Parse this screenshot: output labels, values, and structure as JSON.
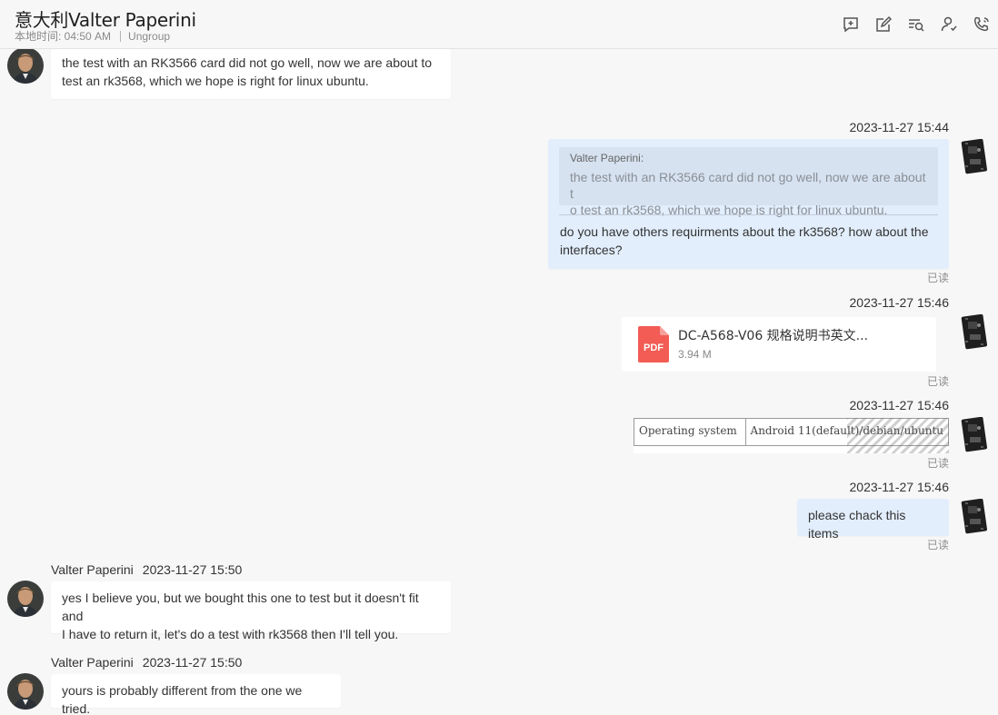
{
  "header": {
    "title": "意大利Valter Paperini",
    "local_time_label": "本地时间: 04:50 AM",
    "group": "Ungroup",
    "tools": [
      "new-message-icon",
      "edit-note-icon",
      "search-history-icon",
      "contact-card-icon",
      "phone-call-icon"
    ]
  },
  "messages": [
    {
      "direction": "incoming",
      "text_line1": "the test with an RK3566 card did not go well, now we are about to",
      "text_line2": "test an rk3568, which we hope is right for linux ubuntu."
    },
    {
      "direction": "outgoing",
      "timestamp": "2023-11-27 15:44",
      "quote_author": "Valter Paperini:",
      "quote_line1": "the test with an RK3566 card did not go well, now we are about t",
      "quote_line2": "o test an rk3568, which we hope is right for linux ubuntu.",
      "text_line1": "do you have others requirments about the rk3568? how about the",
      "text_line2": "interfaces?",
      "status": "已读"
    },
    {
      "direction": "outgoing",
      "timestamp": "2023-11-27 15:46",
      "file_type": "PDF",
      "file_name": "DC-A568-V06 规格说明书英文...",
      "file_size": "3.94 M",
      "status": "已读"
    },
    {
      "direction": "outgoing",
      "timestamp": "2023-11-27 15:46",
      "image_cell1": "Operating system",
      "image_cell2": "Android 11(default)/debian/ubuntu",
      "status": "已读"
    },
    {
      "direction": "outgoing",
      "timestamp": "2023-11-27 15:46",
      "text": "please chack this items",
      "status": "已读"
    },
    {
      "direction": "incoming",
      "sender": "Valter Paperini",
      "timestamp": "2023-11-27 15:50",
      "text_line1": "yes I believe you, but we bought this one to test but it doesn't fit and",
      "text_line2": "I have to return it, let's do a test with rk3568 then I'll tell you."
    },
    {
      "direction": "incoming",
      "sender": "Valter Paperini",
      "timestamp": "2023-11-27 15:50",
      "text": "yours is probably different from the one we tried."
    }
  ],
  "colors": {
    "background": "#f7f7f7",
    "incoming_bubble": "#ffffff",
    "outgoing_bubble": "#e2eefc",
    "quote_box": "#d6e2f0",
    "pdf_red": "#f25c54"
  }
}
